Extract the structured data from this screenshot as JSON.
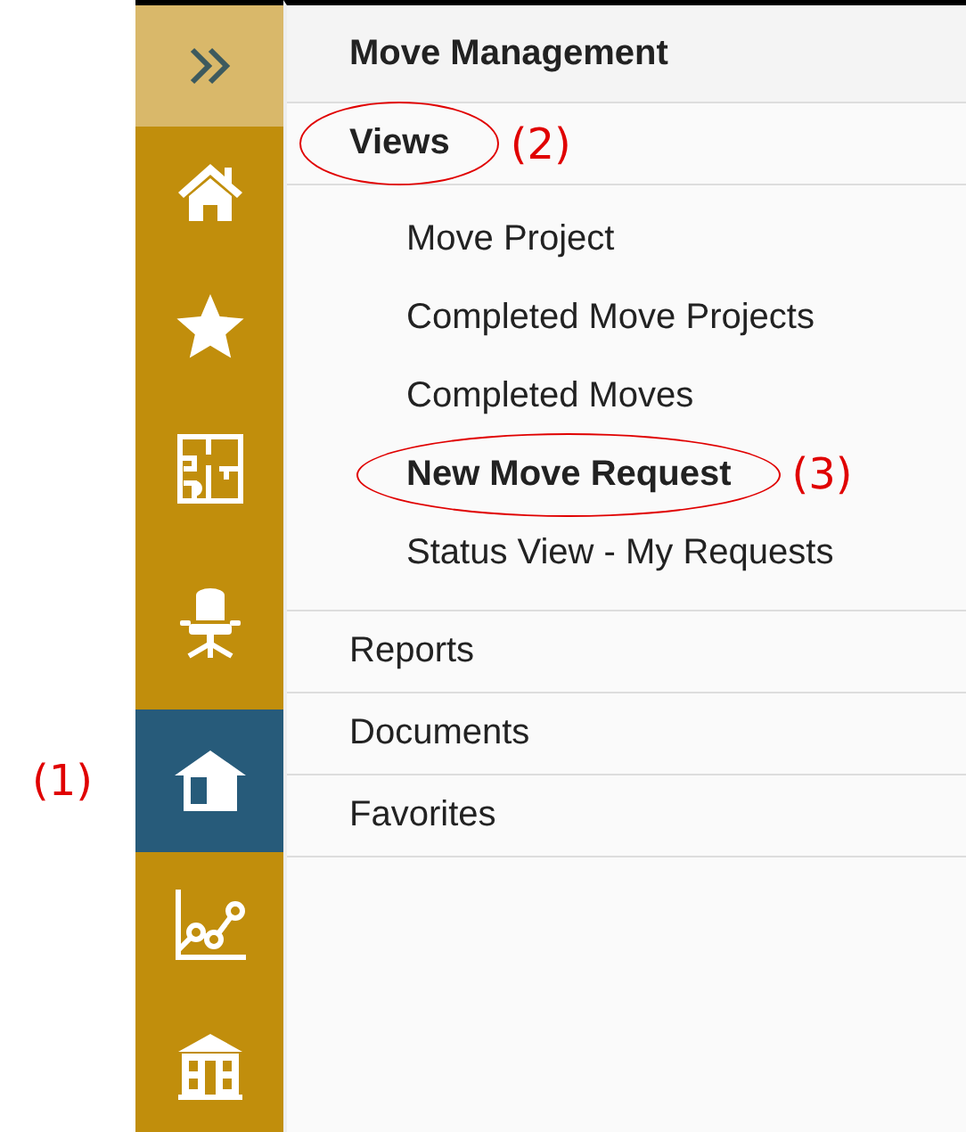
{
  "sidebar": {
    "items": [
      {
        "kind": "expand",
        "selected": false
      },
      {
        "kind": "home",
        "selected": false
      },
      {
        "kind": "star",
        "selected": false
      },
      {
        "kind": "floorplan",
        "selected": false
      },
      {
        "kind": "chair",
        "selected": false
      },
      {
        "kind": "box",
        "selected": true,
        "annotation": "(1)"
      },
      {
        "kind": "chart",
        "selected": false
      },
      {
        "kind": "building",
        "selected": false
      }
    ]
  },
  "menu": {
    "title": "Move Management",
    "sections": [
      {
        "label": "Views",
        "expanded": true,
        "circled": true,
        "annotation": "(2)",
        "children": [
          {
            "label": "Move Project",
            "selected": false
          },
          {
            "label": "Completed Move Projects",
            "selected": false
          },
          {
            "label": "Completed Moves",
            "selected": false
          },
          {
            "label": "New Move Request",
            "selected": true,
            "circled": true,
            "annotation": "(3)"
          },
          {
            "label": "Status View - My Requests",
            "selected": false
          }
        ]
      },
      {
        "label": "Reports",
        "expanded": false
      },
      {
        "label": "Documents",
        "expanded": false
      },
      {
        "label": "Favorites",
        "expanded": false
      }
    ]
  }
}
